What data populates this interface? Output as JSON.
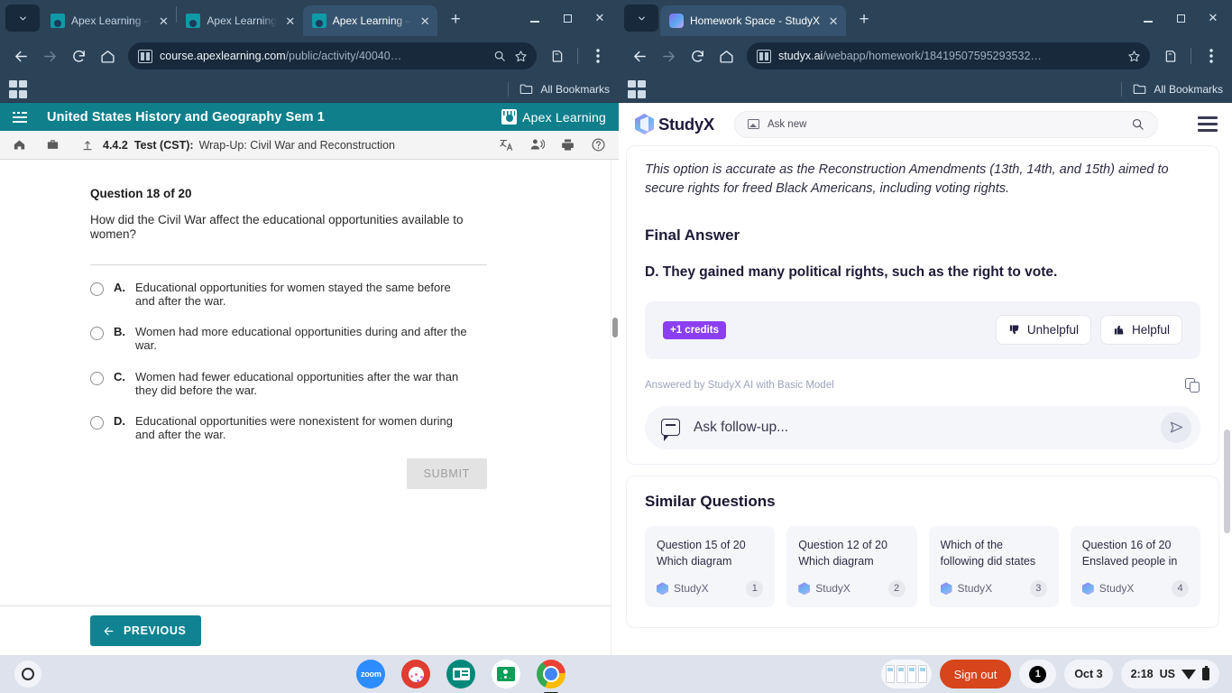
{
  "window_left": {
    "tabs": [
      {
        "title": "Apex Learning –",
        "favicon": "apex-favicon",
        "active": false
      },
      {
        "title": "Apex Learning",
        "favicon": "apex-favicon",
        "active": false
      },
      {
        "title": "Apex Learning –",
        "favicon": "apex-favicon",
        "active": true
      }
    ],
    "new_tab_label": "+",
    "omnibox": {
      "url_bold": "course.apexlearning.com",
      "url_rest": "/public/activity/40040…"
    },
    "bookmarks_label": "All Bookmarks",
    "page": {
      "course_title": "United States History and Geography Sem 1",
      "brand": "Apex Learning",
      "breadcrumb": {
        "number": "4.4.2",
        "type": "Test (CST):",
        "name": "Wrap-Up: Civil War and Reconstruction"
      },
      "question_number": "Question 18 of 20",
      "question_text": "How did the Civil War affect the educational opportunities available to women?",
      "choices": [
        {
          "letter": "A.",
          "text": "Educational opportunities for women stayed the same before and after the war."
        },
        {
          "letter": "B.",
          "text": "Women had more educational opportunities during and after the war."
        },
        {
          "letter": "C.",
          "text": "Women had fewer educational opportunities after the war than they did before the war."
        },
        {
          "letter": "D.",
          "text": "Educational opportunities were nonexistent for women during and after the war."
        }
      ],
      "submit_label": "SUBMIT",
      "previous_label": "PREVIOUS"
    }
  },
  "window_right": {
    "tabs": [
      {
        "title": "Homework Space - StudyX",
        "favicon": "studyx-favicon",
        "active": true
      }
    ],
    "new_tab_label": "+",
    "omnibox": {
      "url_bold": "studyx.ai",
      "url_rest": "/webapp/homework/18419507595293532…"
    },
    "bookmarks_label": "All Bookmarks",
    "page": {
      "brand": "StudyX",
      "search_placeholder": "Ask new",
      "explanation": "This option is accurate as the Reconstruction Amendments (13th, 14th, and 15th) aimed to secure rights for freed Black Americans, including voting rights.",
      "final_answer_heading": "Final Answer",
      "final_answer": "D. They gained many political rights, such as the right to vote.",
      "credits_badge": "+1 credits",
      "unhelpful_label": "Unhelpful",
      "helpful_label": "Helpful",
      "answered_by": "Answered by StudyX AI with Basic Model",
      "followup_placeholder": "Ask follow-up...",
      "similar_questions_title": "Similar Questions",
      "similar_questions": [
        {
          "text": "Question 15 of 20 Which diagram",
          "brand": "StudyX",
          "index": "1"
        },
        {
          "text": "Question 12 of 20 Which diagram",
          "brand": "StudyX",
          "index": "2"
        },
        {
          "text": "Which of the following did states",
          "brand": "StudyX",
          "index": "3"
        },
        {
          "text": "Question 16 of 20 Enslaved people in",
          "brand": "StudyX",
          "index": "4"
        }
      ]
    }
  },
  "shelf": {
    "apps": [
      {
        "name": "zoom",
        "label": "zoom"
      },
      {
        "name": "paint",
        "label": ""
      },
      {
        "name": "news",
        "label": ""
      },
      {
        "name": "classroom",
        "label": ""
      },
      {
        "name": "chrome",
        "label": ""
      }
    ],
    "sign_out_label": "Sign out",
    "notification_count": "1",
    "date": "Oct 3",
    "time": "2:18",
    "locale": "US"
  },
  "colors": {
    "apex_teal": "#0f7f8c",
    "studyx_purple": "#8b3ff0",
    "chrome_frame": "#2b4257",
    "signout_orange": "#d6451b"
  }
}
